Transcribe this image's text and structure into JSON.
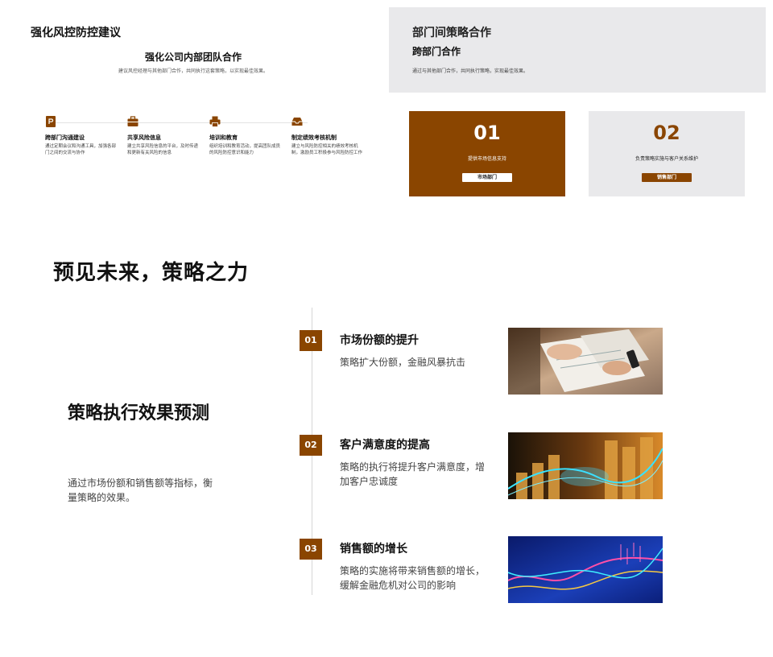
{
  "slide1": {
    "title": "强化风控防控建议",
    "subtitle": "强化公司内部团队合作",
    "description": "建议风控经理与其他部门合作，共同执行这套策略，以实现最佳效果。",
    "steps": [
      {
        "icon": "parking-sign-icon",
        "title": "跨部门沟通建设",
        "desc": "通过定期会议和沟通工具，加强各部门之间的交流与协作"
      },
      {
        "icon": "briefcase-icon",
        "title": "共享风险信息",
        "desc": "建立共享风险信息的平台，及时传递和更新有关风险的信息"
      },
      {
        "icon": "printer-icon",
        "title": "培训和教育",
        "desc": "组织培训和教育活动，提高团队成员的风险防控意识和能力"
      },
      {
        "icon": "inbox-icon",
        "title": "制定绩效考核机制",
        "desc": "建立与风险防控相关的绩效考核机制，激励员工积极参与风险防控工作"
      }
    ],
    "accent": "#8a4500"
  },
  "slide2": {
    "title": "部门间策略合作",
    "subtitle": "跨部门合作",
    "description": "通过与其他部门合作，共同执行策略，实现最佳效果。",
    "cards": [
      {
        "number": "01",
        "desc": "提供市场信息支持",
        "tag": "市场部门"
      },
      {
        "number": "02",
        "desc": "负责策略实施与客户关系维护",
        "tag": "销售部门"
      }
    ]
  },
  "slide3": {
    "title": "预见未来，策略之力",
    "heading": "策略执行效果预测",
    "description": "通过市场份额和销售额等指标，衡量策略的效果。",
    "items": [
      {
        "badge": "01",
        "title": "市场份额的提升",
        "desc": "策略扩大份额，金融风暴抗击",
        "image": "people-reviewing-documents-photo"
      },
      {
        "badge": "02",
        "title": "客户满意度的提高",
        "desc": "策略的执行将提升客户满意度，增加客户忠诚度",
        "image": "coins-and-financial-chart-photo"
      },
      {
        "badge": "03",
        "title": "销售额的增长",
        "desc": "策略的实施将带来销售额的增长，缓解金融危机对公司的影响",
        "image": "stock-market-graph-photo"
      }
    ]
  }
}
